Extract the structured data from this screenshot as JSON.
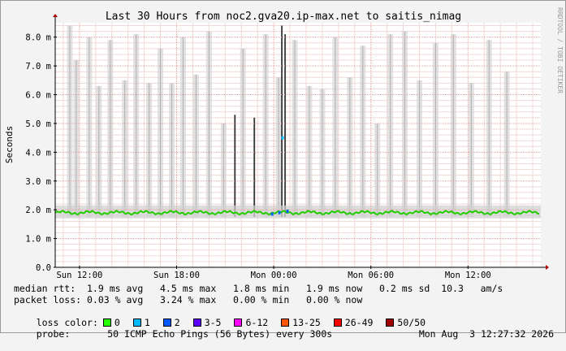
{
  "chart_data": {
    "type": "line",
    "title": "Last 30 Hours from noc2.gva20.ip-max.net to saitis_nimag",
    "ylabel": "Seconds",
    "watermark": "RRDTOOL / TOBI OETIKER",
    "ylim": [
      0,
      8.5
    ],
    "yticks": [
      {
        "v": 0,
        "label": "0.0"
      },
      {
        "v": 1,
        "label": "1.0 m"
      },
      {
        "v": 2,
        "label": "2.0 m"
      },
      {
        "v": 3,
        "label": "3.0 m"
      },
      {
        "v": 4,
        "label": "4.0 m"
      },
      {
        "v": 5,
        "label": "5.0 m"
      },
      {
        "v": 6,
        "label": "6.0 m"
      },
      {
        "v": 7,
        "label": "7.0 m"
      },
      {
        "v": 8,
        "label": "8.0 m"
      }
    ],
    "xlim": [
      -1.5,
      28.5
    ],
    "xticks": [
      {
        "v": 0,
        "label": "Sun 12:00"
      },
      {
        "v": 6,
        "label": "Sun 18:00"
      },
      {
        "v": 12,
        "label": "Mon 00:00"
      },
      {
        "v": 18,
        "label": "Mon 06:00"
      },
      {
        "v": 24,
        "label": "Mon 12:00"
      }
    ],
    "median_ms": 1.9,
    "spikes": [
      {
        "x": -0.6,
        "top": 8.4,
        "dark": false
      },
      {
        "x": -0.2,
        "top": 7.2,
        "dark": false
      },
      {
        "x": 0.6,
        "top": 8.0,
        "dark": false
      },
      {
        "x": 1.2,
        "top": 6.3,
        "dark": false
      },
      {
        "x": 1.9,
        "top": 7.9,
        "dark": false
      },
      {
        "x": 2.8,
        "top": 6.5,
        "dark": false
      },
      {
        "x": 3.5,
        "top": 8.1,
        "dark": false
      },
      {
        "x": 4.3,
        "top": 6.4,
        "dark": false
      },
      {
        "x": 5.0,
        "top": 7.6,
        "dark": false
      },
      {
        "x": 5.7,
        "top": 6.4,
        "dark": false
      },
      {
        "x": 6.4,
        "top": 8.0,
        "dark": false
      },
      {
        "x": 7.2,
        "top": 6.7,
        "dark": false
      },
      {
        "x": 8.0,
        "top": 8.2,
        "dark": false
      },
      {
        "x": 8.9,
        "top": 5.0,
        "dark": false
      },
      {
        "x": 9.6,
        "top": 5.3,
        "dark": true
      },
      {
        "x": 10.1,
        "top": 7.6,
        "dark": false
      },
      {
        "x": 10.8,
        "top": 5.2,
        "dark": true
      },
      {
        "x": 11.5,
        "top": 8.1,
        "dark": false
      },
      {
        "x": 12.3,
        "top": 6.6,
        "dark": false
      },
      {
        "x": 12.5,
        "top": 8.4,
        "dark": true
      },
      {
        "x": 12.7,
        "top": 8.1,
        "dark": true
      },
      {
        "x": 13.3,
        "top": 7.9,
        "dark": false
      },
      {
        "x": 14.2,
        "top": 6.3,
        "dark": false
      },
      {
        "x": 15.0,
        "top": 6.2,
        "dark": false
      },
      {
        "x": 15.8,
        "top": 8.0,
        "dark": false
      },
      {
        "x": 16.7,
        "top": 6.6,
        "dark": false
      },
      {
        "x": 17.5,
        "top": 7.7,
        "dark": false
      },
      {
        "x": 18.4,
        "top": 5.0,
        "dark": false
      },
      {
        "x": 19.2,
        "top": 8.1,
        "dark": false
      },
      {
        "x": 20.1,
        "top": 8.2,
        "dark": false
      },
      {
        "x": 21.0,
        "top": 6.5,
        "dark": false
      },
      {
        "x": 22.0,
        "top": 7.8,
        "dark": false
      },
      {
        "x": 23.1,
        "top": 8.1,
        "dark": false
      },
      {
        "x": 24.2,
        "top": 6.4,
        "dark": false
      },
      {
        "x": 25.3,
        "top": 7.9,
        "dark": false
      },
      {
        "x": 26.4,
        "top": 6.8,
        "dark": false
      }
    ],
    "blips": [
      {
        "x": 11.9,
        "y": 1.85,
        "color": "#0066ff"
      },
      {
        "x": 12.35,
        "y": 1.9,
        "color": "#0066ff"
      },
      {
        "x": 12.55,
        "y": 4.5,
        "color": "#00bbff"
      },
      {
        "x": 12.85,
        "y": 1.95,
        "color": "#0066ff"
      }
    ]
  },
  "stats": {
    "median_rtt": "median rtt:  1.9 ms avg   4.5 ms max   1.8 ms min   1.9 ms now   0.2 ms sd  10.3   am/s",
    "packet_loss": "packet loss: 0.03 % avg   3.24 % max   0.00 % min   0.00 % now",
    "loss_color_label": "loss color:",
    "loss_colors": [
      {
        "label": "0",
        "color": "#26ff00"
      },
      {
        "label": "1",
        "color": "#00b8ff"
      },
      {
        "label": "2",
        "color": "#0059ff"
      },
      {
        "label": "3-5",
        "color": "#5e00ff"
      },
      {
        "label": "6-12",
        "color": "#ff00ff"
      },
      {
        "label": "13-25",
        "color": "#ff5500"
      },
      {
        "label": "26-49",
        "color": "#ff0000"
      },
      {
        "label": "50/50",
        "color": "#a10000"
      }
    ],
    "probe_label": "probe:",
    "probe": "50 ICMP Echo Pings (56 Bytes) every 300s",
    "timestamp": "Mon Aug  3 12:27:32 2026"
  }
}
